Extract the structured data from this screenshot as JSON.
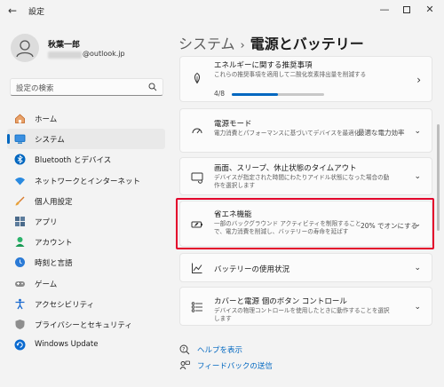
{
  "window": {
    "title": "設定",
    "back_glyph": "←",
    "minimize_glyph": "—",
    "close_glyph": "✕"
  },
  "profile": {
    "name": "秋葉一郎",
    "email_domain": "@outlook.jp"
  },
  "search": {
    "placeholder": "設定の検索"
  },
  "nav": {
    "items": [
      {
        "label": "ホーム",
        "icon": "home-icon",
        "color": "#d0742a"
      },
      {
        "label": "システム",
        "icon": "system-icon",
        "color": "#0067c0",
        "active": true
      },
      {
        "label": "Bluetooth とデバイス",
        "icon": "bluetooth-icon",
        "color": "#0067c0"
      },
      {
        "label": "ネットワークとインターネット",
        "icon": "wifi-icon",
        "color": "#1a7fd6"
      },
      {
        "label": "個人用設定",
        "icon": "brush-icon",
        "color": "#c8641e"
      },
      {
        "label": "アプリ",
        "icon": "apps-icon",
        "color": "#3a5a7a"
      },
      {
        "label": "アカウント",
        "icon": "account-icon",
        "color": "#1aa260"
      },
      {
        "label": "時刻と言語",
        "icon": "globe-clock-icon",
        "color": "#1a6ad0"
      },
      {
        "label": "ゲーム",
        "icon": "gamepad-icon",
        "color": "#777777"
      },
      {
        "label": "アクセシビリティ",
        "icon": "accessibility-icon",
        "color": "#1a6ad0"
      },
      {
        "label": "プライバシーとセキュリティ",
        "icon": "shield-icon",
        "color": "#777777"
      },
      {
        "label": "Windows Update",
        "icon": "update-icon",
        "color": "#0a6ad0"
      }
    ]
  },
  "main": {
    "breadcrumb_parent": "システム",
    "breadcrumb_separator": "›",
    "page_title": "電源とバッテリー",
    "cards": [
      {
        "title": "エネルギーに関する推奨事項",
        "description": "これらの推奨事項を適用して二酸化炭素排出量を削減する",
        "progress_text": "4/8",
        "progress": 0.5,
        "icon": "leaf-icon",
        "chevron": "›"
      },
      {
        "title": "電源モード",
        "description": "電力消費とパフォーマンスに基づいてデバイスを最適化",
        "value": "最適な電力効率",
        "icon": "power-mode-icon",
        "chevron": "⌄"
      },
      {
        "title": "画面、スリープ、休止状態のタイムアウト",
        "description": "デバイスが指定された時間にわたりアイドル状態になった場合の動作を選択します",
        "icon": "screen-sleep-icon",
        "chevron": "⌄"
      },
      {
        "title": "省エネ機能",
        "description": "一部のバックグラウンド アクティビティを制限することで、電力消費を削減し、バッテリーの寿命を延ばす",
        "value": "20% でオンにする",
        "icon": "battery-saver-icon",
        "chevron": "⌄"
      },
      {
        "title": "バッテリーの使用状況",
        "icon": "usage-chart-icon",
        "chevron": "⌄"
      },
      {
        "title": "カバーと電源 個のボタン コントロール",
        "description": "デバイスの物理コントロールを使用したときに動作することを選択します",
        "icon": "controls-icon",
        "chevron": "⌄"
      }
    ],
    "links": [
      {
        "label": "ヘルプを表示",
        "icon": "help-icon"
      },
      {
        "label": "フィードバックの送信",
        "icon": "feedback-icon"
      }
    ]
  },
  "colors": {
    "accent": "#0067c0",
    "highlight": "#e3002b",
    "background": "#f3f3f3",
    "card": "#fbfbfb"
  }
}
